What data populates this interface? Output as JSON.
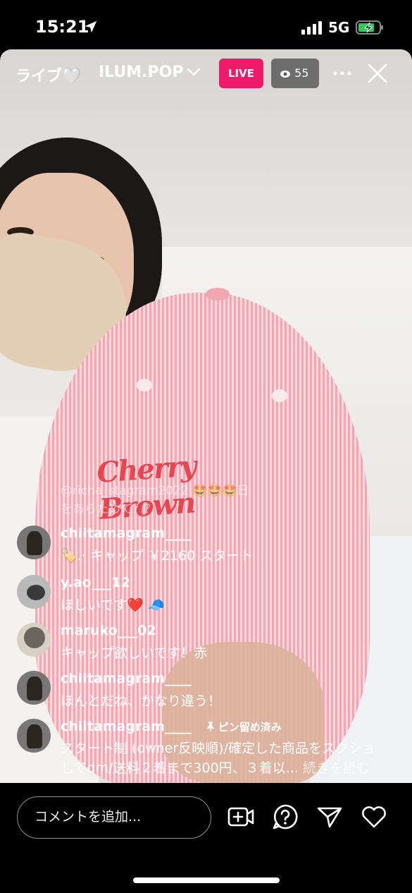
{
  "status": {
    "time": "15:21",
    "network": "5G"
  },
  "header": {
    "live_title": "ライブ🤍",
    "channel": "ILUM.POP",
    "live_badge": "LIVE",
    "viewer_count": "55"
  },
  "overlay": {
    "ghost_line1": "@richa_stagram2022 🤩🤩🤩日",
    "ghost_line2": "をあらためて？？",
    "embroidery": "Cherry\nBrown"
  },
  "comments": [
    {
      "user": "chiitamagram____",
      "text": "🏷️.· キャップ ￥2160 スタート"
    },
    {
      "user": "y.ao___12",
      "text": "ほしいです❤️ 🧢"
    },
    {
      "user": "maruko___02",
      "text": "キャップ欲しいです！赤"
    },
    {
      "user": "chiitamagram____",
      "text": "ほんとだね、かなり違う！"
    },
    {
      "user": "chiitamagram____",
      "pinned": "ピン留め済み",
      "text_line1": "スタート制 (owner反映順)/確定した商品をスクショ",
      "text_line2": "してdm/送料２着まで300円、３着以...",
      "more": "続きを読む"
    }
  ],
  "composer": {
    "placeholder": "コメントを追加..."
  },
  "colors": {
    "live": "#f01a6a",
    "background": "#000000"
  },
  "icons": [
    "location-arrow-icon",
    "signal-icon",
    "battery-icon",
    "chevron-down-icon",
    "eye-icon",
    "more-icon",
    "close-icon",
    "add-video-icon",
    "question-icon",
    "send-icon",
    "heart-icon"
  ]
}
